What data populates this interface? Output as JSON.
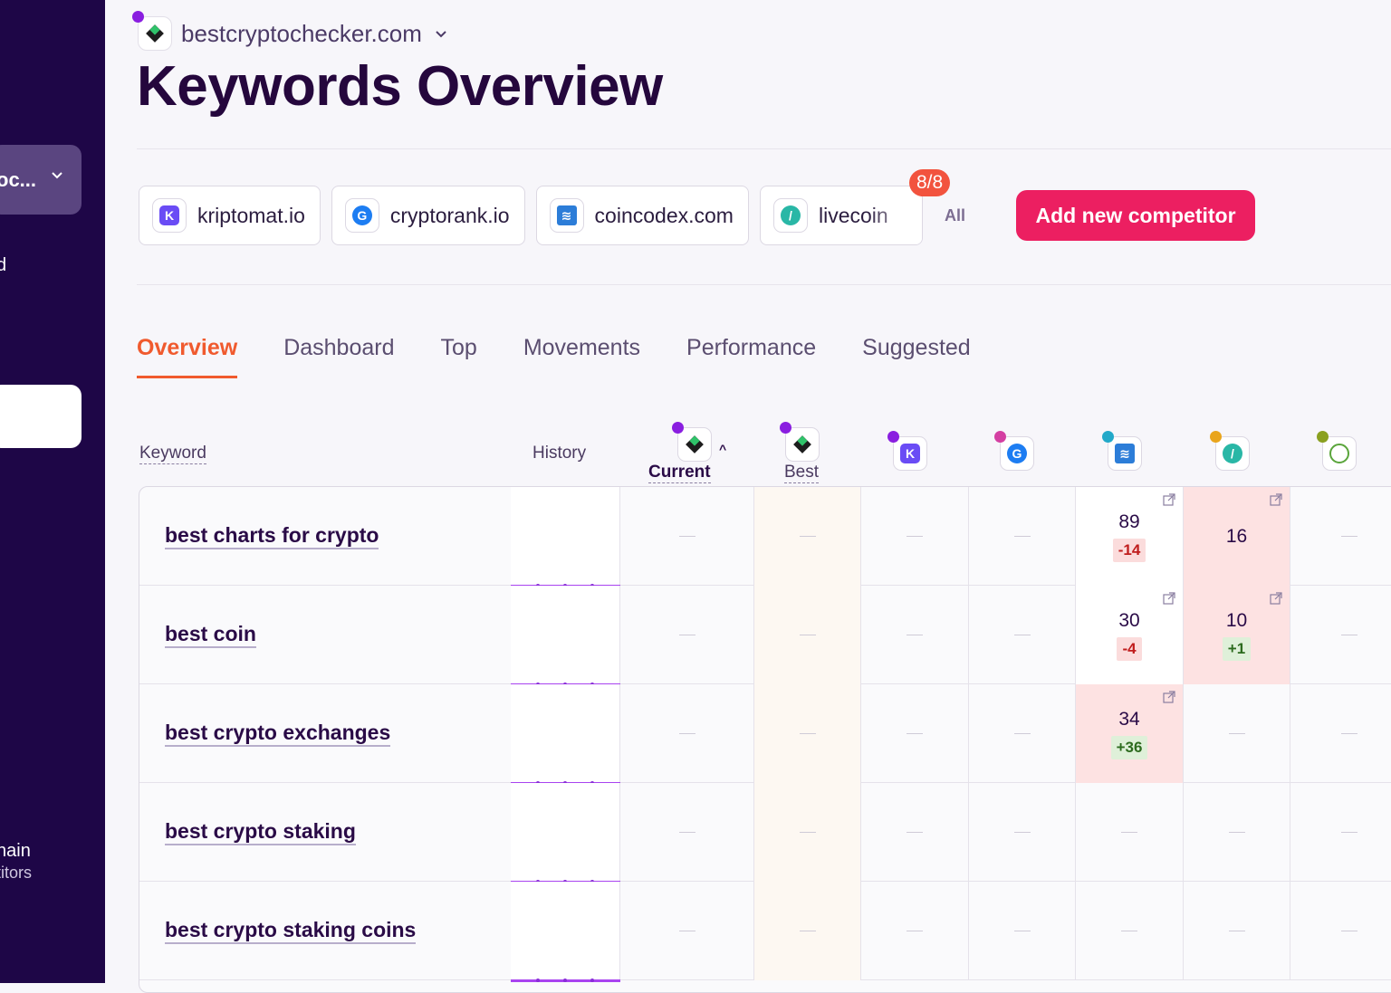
{
  "sidebar": {
    "project_label": "oc...",
    "item_d": "d",
    "domain_label": "nain",
    "domain_sub": "titors"
  },
  "header": {
    "domain": "bestcryptochecker.com",
    "title": "Keywords Overview"
  },
  "competitors": [
    {
      "name": "kriptomat.io",
      "icon": "K"
    },
    {
      "name": "cryptorank.io",
      "icon": "G"
    },
    {
      "name": "coincodex.com",
      "icon": "C"
    },
    {
      "name": "livecoin",
      "icon": "L"
    }
  ],
  "competitor_count": "8/8",
  "all_label": "All",
  "add_button": "Add new competitor",
  "tabs": [
    "Overview",
    "Dashboard",
    "Top",
    "Movements",
    "Performance",
    "Suggested"
  ],
  "table": {
    "headers": {
      "keyword": "Keyword",
      "history": "History",
      "current": "Current",
      "best": "Best"
    },
    "rows": [
      {
        "keyword": "best charts for crypto",
        "coincodex": {
          "rank": "89",
          "delta": "-14"
        },
        "livecoin": {
          "rank": "16",
          "delta": ""
        }
      },
      {
        "keyword": "best coin",
        "coincodex": {
          "rank": "30",
          "delta": "-4"
        },
        "livecoin": {
          "rank": "10",
          "delta": "+1"
        }
      },
      {
        "keyword": "best crypto exchanges",
        "coincodex": {
          "rank": "34",
          "delta": "+36"
        },
        "livecoin": null
      },
      {
        "keyword": "best crypto staking",
        "coincodex": null,
        "livecoin": null
      },
      {
        "keyword": "best crypto staking coins",
        "coincodex": null,
        "livecoin": null
      }
    ]
  },
  "colors": {
    "sidebar": "#1e0647",
    "accent": "#ec1f61",
    "active_tab": "#f05a2e"
  }
}
